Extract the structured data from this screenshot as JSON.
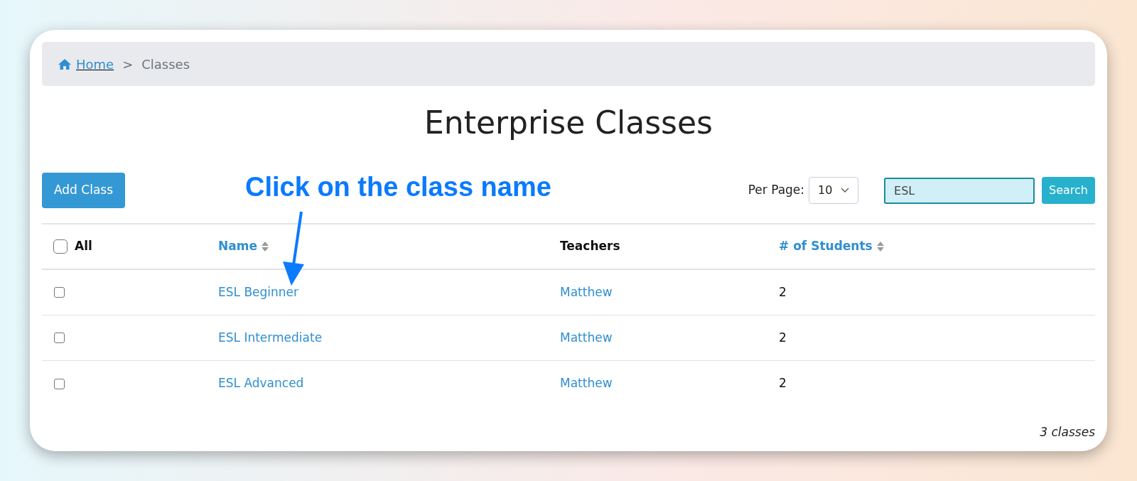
{
  "breadcrumb": {
    "home": "Home",
    "separator": ">",
    "current": "Classes"
  },
  "title": "Enterprise Classes",
  "add_button": "Add Class",
  "annotation": {
    "text": "Click on the class name"
  },
  "per_page": {
    "label": "Per Page:",
    "value": "10"
  },
  "search": {
    "value": "ESL",
    "button": "Search"
  },
  "table": {
    "select_all": {
      "label": "All",
      "checked": false
    },
    "columns": [
      {
        "label": "Name",
        "sortable": true
      },
      {
        "label": "Teachers",
        "sortable": false
      },
      {
        "label": "# of Students",
        "sortable": true
      }
    ],
    "rows": [
      {
        "checked": false,
        "name": "ESL Beginner",
        "teacher": "Matthew",
        "students": "2"
      },
      {
        "checked": false,
        "name": "ESL Intermediate",
        "teacher": "Matthew",
        "students": "2"
      },
      {
        "checked": false,
        "name": "ESL Advanced",
        "teacher": "Matthew",
        "students": "2"
      }
    ]
  },
  "footer": "3 classes"
}
